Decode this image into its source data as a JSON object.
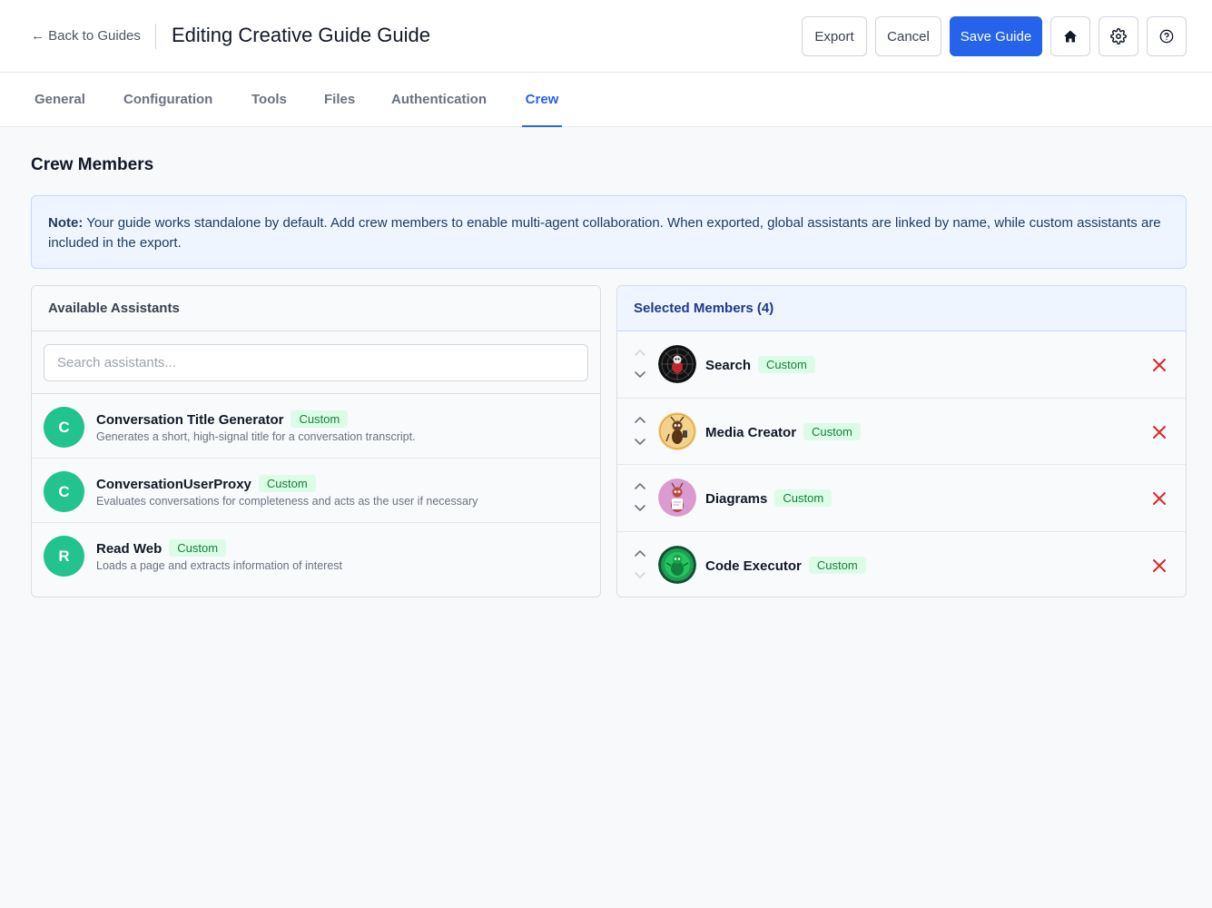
{
  "header": {
    "back_label": "← Back to Guides",
    "title": "Editing Creative Guide Guide",
    "export_label": "Export",
    "cancel_label": "Cancel",
    "save_label": "Save Guide",
    "icons": [
      "home-icon",
      "gear-icon",
      "help-icon"
    ]
  },
  "tabs": [
    {
      "label": "General",
      "active": false
    },
    {
      "label": "Configuration",
      "active": false
    },
    {
      "label": "Tools",
      "active": false
    },
    {
      "label": "Files",
      "active": false
    },
    {
      "label": "Authentication",
      "active": false
    },
    {
      "label": "Crew",
      "active": true
    }
  ],
  "crew": {
    "title": "Crew Members",
    "note_label": "Note:",
    "note_text": " Your guide works standalone by default. Add crew members to enable multi-agent collaboration. When exported, global assistants are linked by name, while custom assistants are included in the export."
  },
  "available": {
    "title": "Available Assistants",
    "search_placeholder": "Search assistants...",
    "items": [
      {
        "letter": "C",
        "name": "Conversation Title Generator",
        "badge": "Custom",
        "desc": "Generates a short, high-signal title for a conversation transcript."
      },
      {
        "letter": "C",
        "name": "ConversationUserProxy",
        "badge": "Custom",
        "desc": "Evaluates conversations for completeness and acts as the user if necessary"
      },
      {
        "letter": "R",
        "name": "Read Web",
        "badge": "Custom",
        "desc": "Loads a page and extracts information of interest"
      }
    ]
  },
  "selected": {
    "title": "Selected Members (4)",
    "items": [
      {
        "name": "Search",
        "badge": "Custom",
        "avatar": "spider-avatar"
      },
      {
        "name": "Media Creator",
        "badge": "Custom",
        "avatar": "ant-artist-avatar"
      },
      {
        "name": "Diagrams",
        "badge": "Custom",
        "avatar": "ant-drawing-avatar"
      },
      {
        "name": "Code Executor",
        "badge": "Custom",
        "avatar": "green-bug-avatar"
      }
    ]
  },
  "colors": {
    "accent": "#2563eb",
    "avatar_green": "#22c38e",
    "badge_bg": "#dcfce7",
    "badge_text": "#15803d",
    "remove_red": "#dc2626"
  }
}
